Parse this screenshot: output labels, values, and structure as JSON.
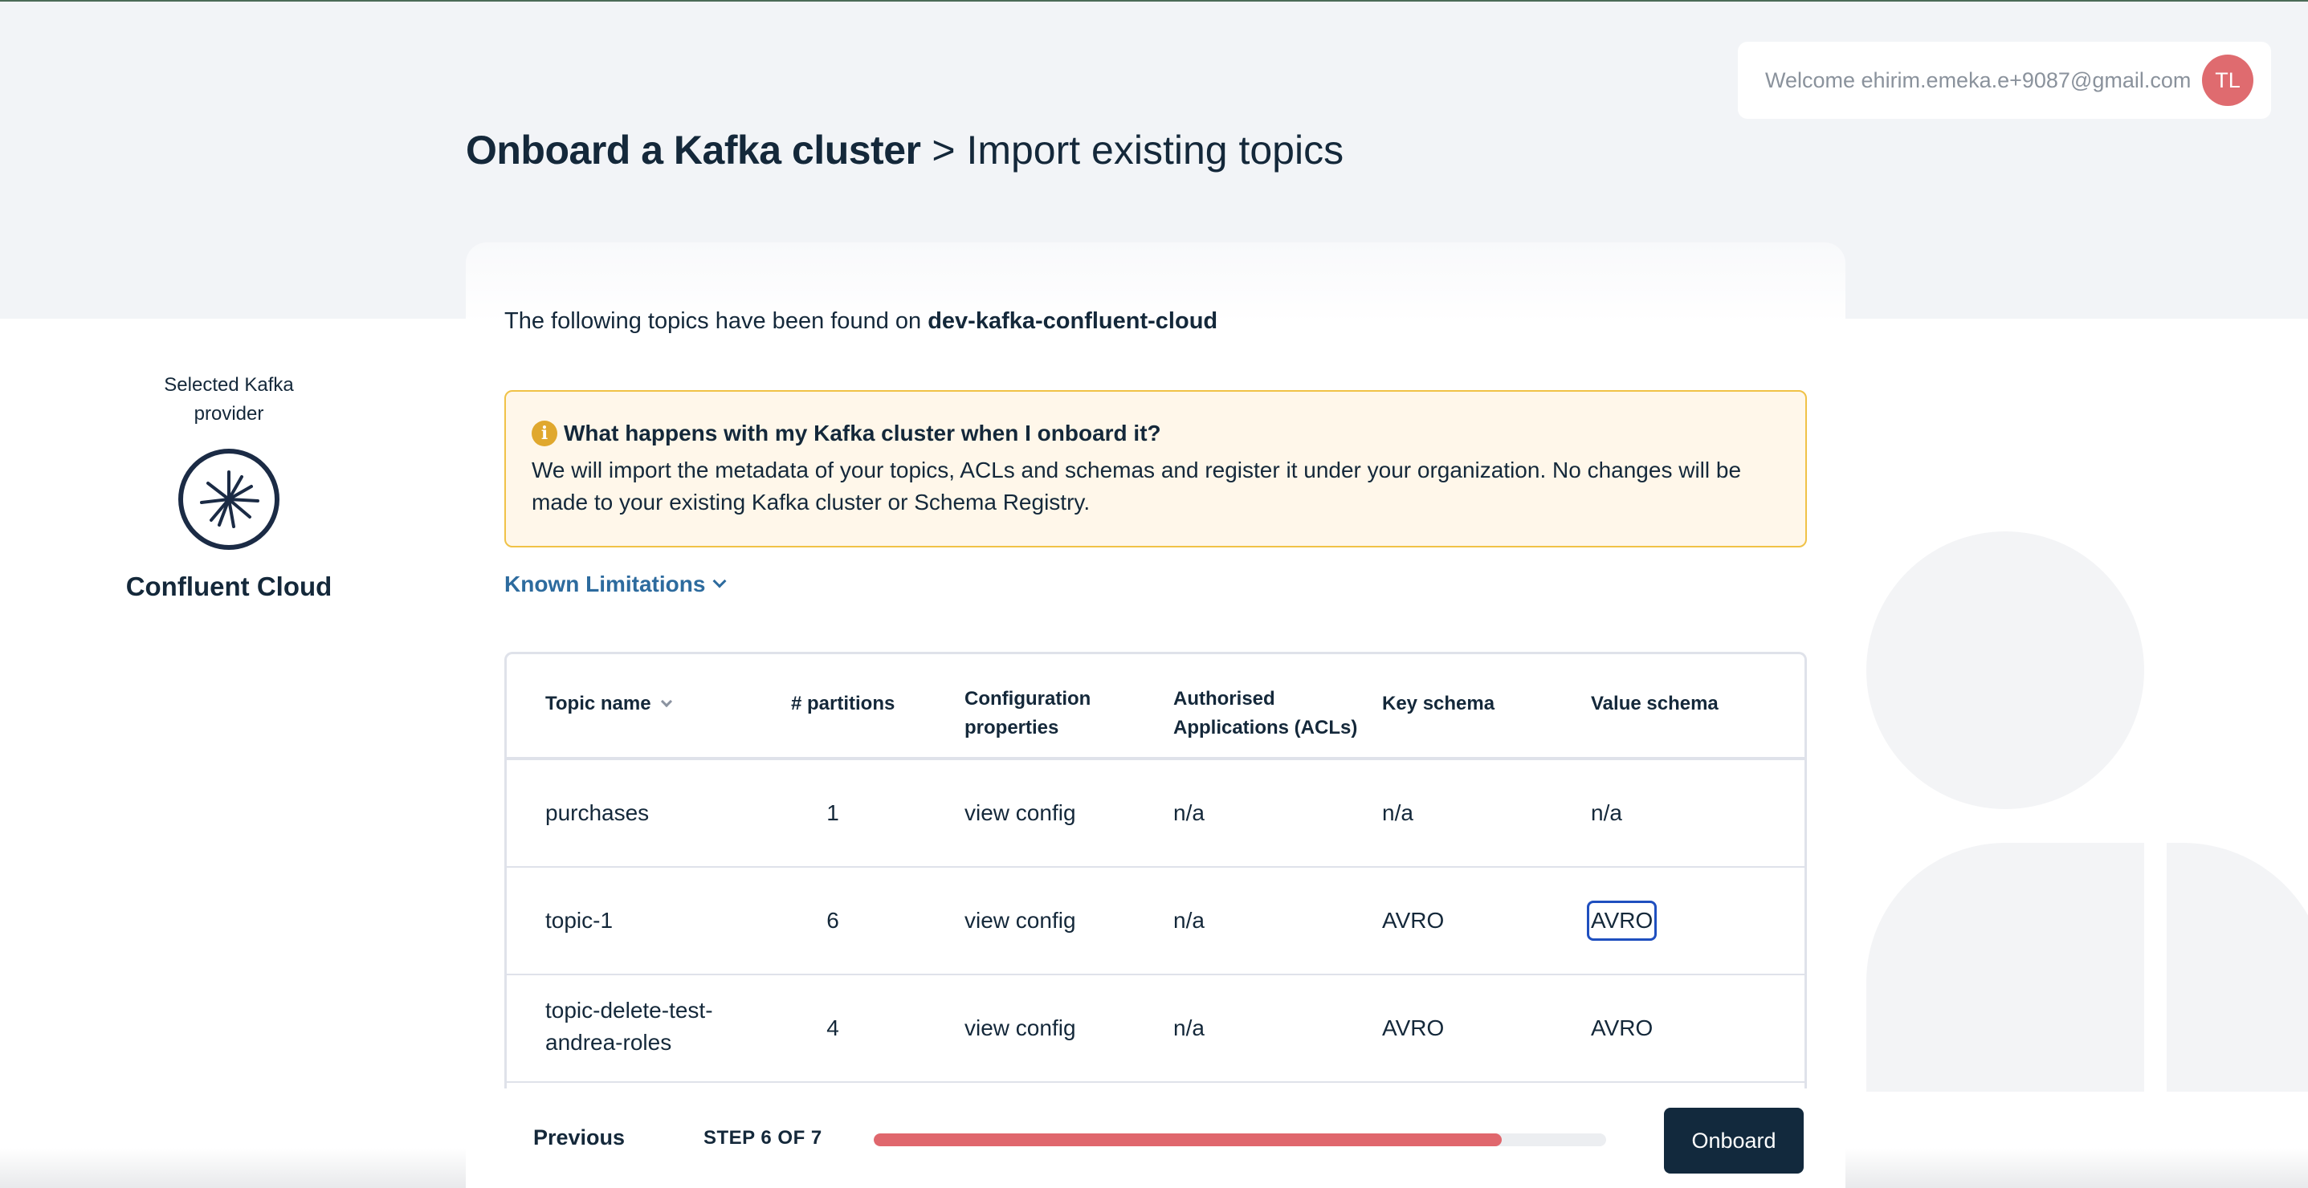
{
  "header": {
    "welcome_text": "Welcome ehirim.emeka.e+9087@gmail.com",
    "avatar_initials": "TL",
    "title_strong": "Onboard a Kafka cluster",
    "title_rest": " > Import existing topics"
  },
  "provider": {
    "label": "Selected Kafka provider",
    "name": "Confluent Cloud"
  },
  "intro": {
    "prefix": "The following topics have been found on ",
    "cluster": "dev-kafka-confluent-cloud"
  },
  "notice": {
    "icon": "info-icon",
    "title": "What happens with my Kafka cluster when I onboard it?",
    "body": "We will import the metadata of your topics, ACLs and schemas and register it under your organization. No changes will be made to your existing Kafka cluster or Schema Registry."
  },
  "known_limitations": "Known Limitations",
  "table": {
    "headers": {
      "topic": "Topic name",
      "partitions": "# partitions",
      "config": "Configuration properties",
      "acls": "Authorised Applications (ACLs)",
      "key": "Key schema",
      "value": "Value schema"
    },
    "rows": [
      {
        "topic": "purchases",
        "partitions": "1",
        "config": "view config",
        "acls": "n/a",
        "key": "n/a",
        "value": "n/a"
      },
      {
        "topic": "topic-1",
        "partitions": "6",
        "config": "view config",
        "acls": "n/a",
        "key": "AVRO",
        "value": "AVRO"
      },
      {
        "topic": "topic-delete-test-andrea-roles",
        "partitions": "4",
        "config": "view config",
        "acls": "n/a",
        "key": "AVRO",
        "value": "AVRO"
      }
    ]
  },
  "footer": {
    "previous": "Previous",
    "step": "STEP 6 OF 7",
    "progress": 0.857,
    "onboard": "Onboard"
  },
  "colors": {
    "accent": "#12293d",
    "progress": "#e0676d",
    "notice_border": "#f0c247",
    "link": "#2d6b9e"
  }
}
